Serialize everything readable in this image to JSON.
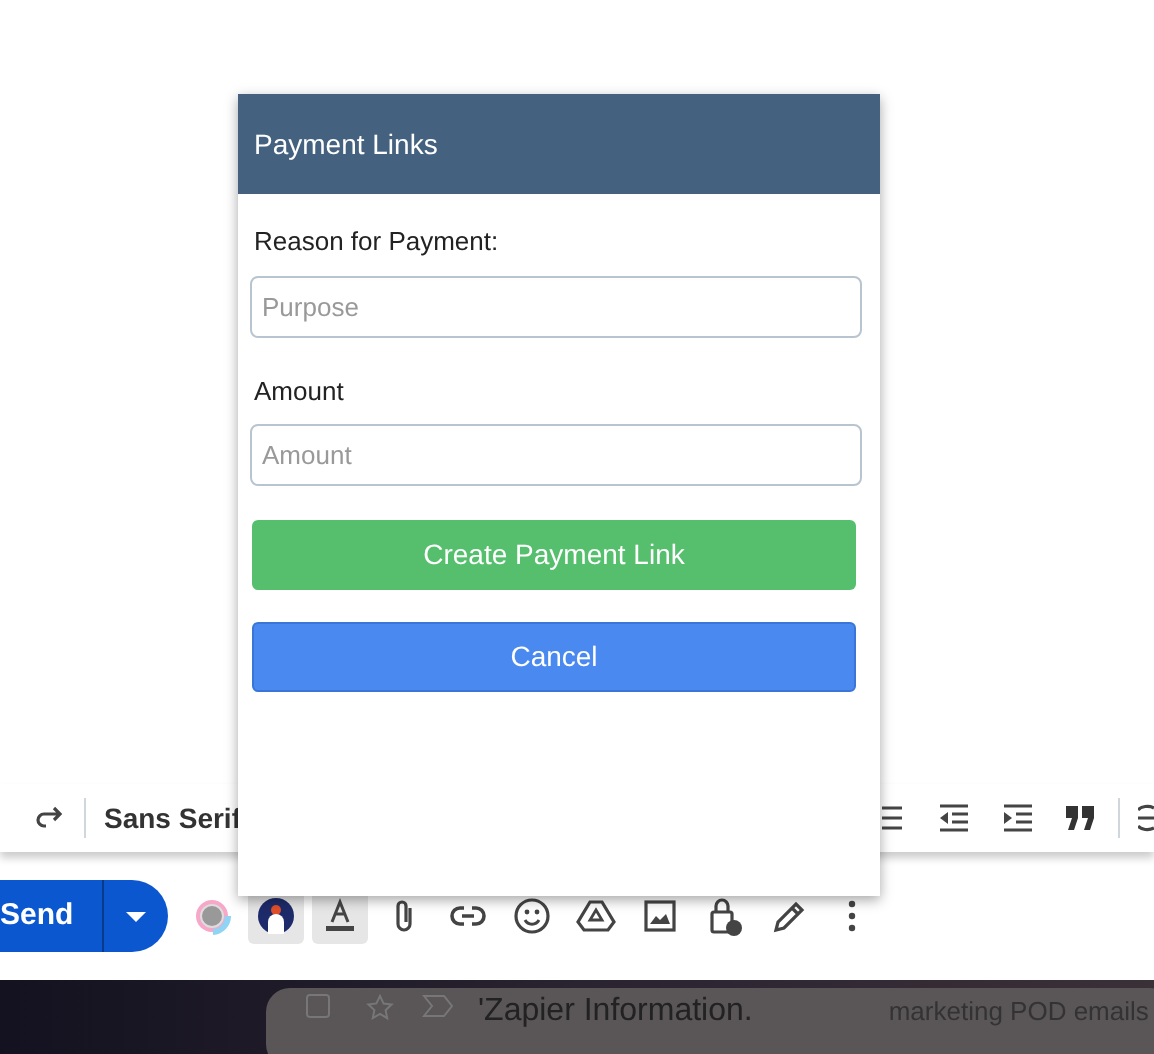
{
  "format_toolbar": {
    "font": "Sans Serif"
  },
  "compose_bar": {
    "send": "Send",
    "tools": [
      {
        "kind": "addon",
        "active": false
      },
      {
        "kind": "avatar",
        "active": true
      },
      {
        "kind": "text-color",
        "active": true
      },
      {
        "kind": "attach",
        "active": false
      },
      {
        "kind": "link",
        "active": false
      },
      {
        "kind": "emoji",
        "active": false
      },
      {
        "kind": "drive",
        "active": false
      },
      {
        "kind": "photo",
        "active": false
      },
      {
        "kind": "lock",
        "active": false
      },
      {
        "kind": "pen",
        "active": false
      },
      {
        "kind": "more",
        "active": false
      }
    ]
  },
  "background_row": {
    "checked": false,
    "subject": "'Zapier Information.",
    "label": "marketing POD emails"
  },
  "dialog": {
    "title": "Payment Links",
    "fields": [
      {
        "label": "Reason for Payment:",
        "placeholder": "Purpose"
      },
      {
        "label": "Amount",
        "placeholder": "Amount"
      }
    ],
    "buttons": [
      {
        "label": "Create Payment Link",
        "kind": "primary"
      },
      {
        "label": "Cancel",
        "kind": "secondary"
      }
    ]
  }
}
